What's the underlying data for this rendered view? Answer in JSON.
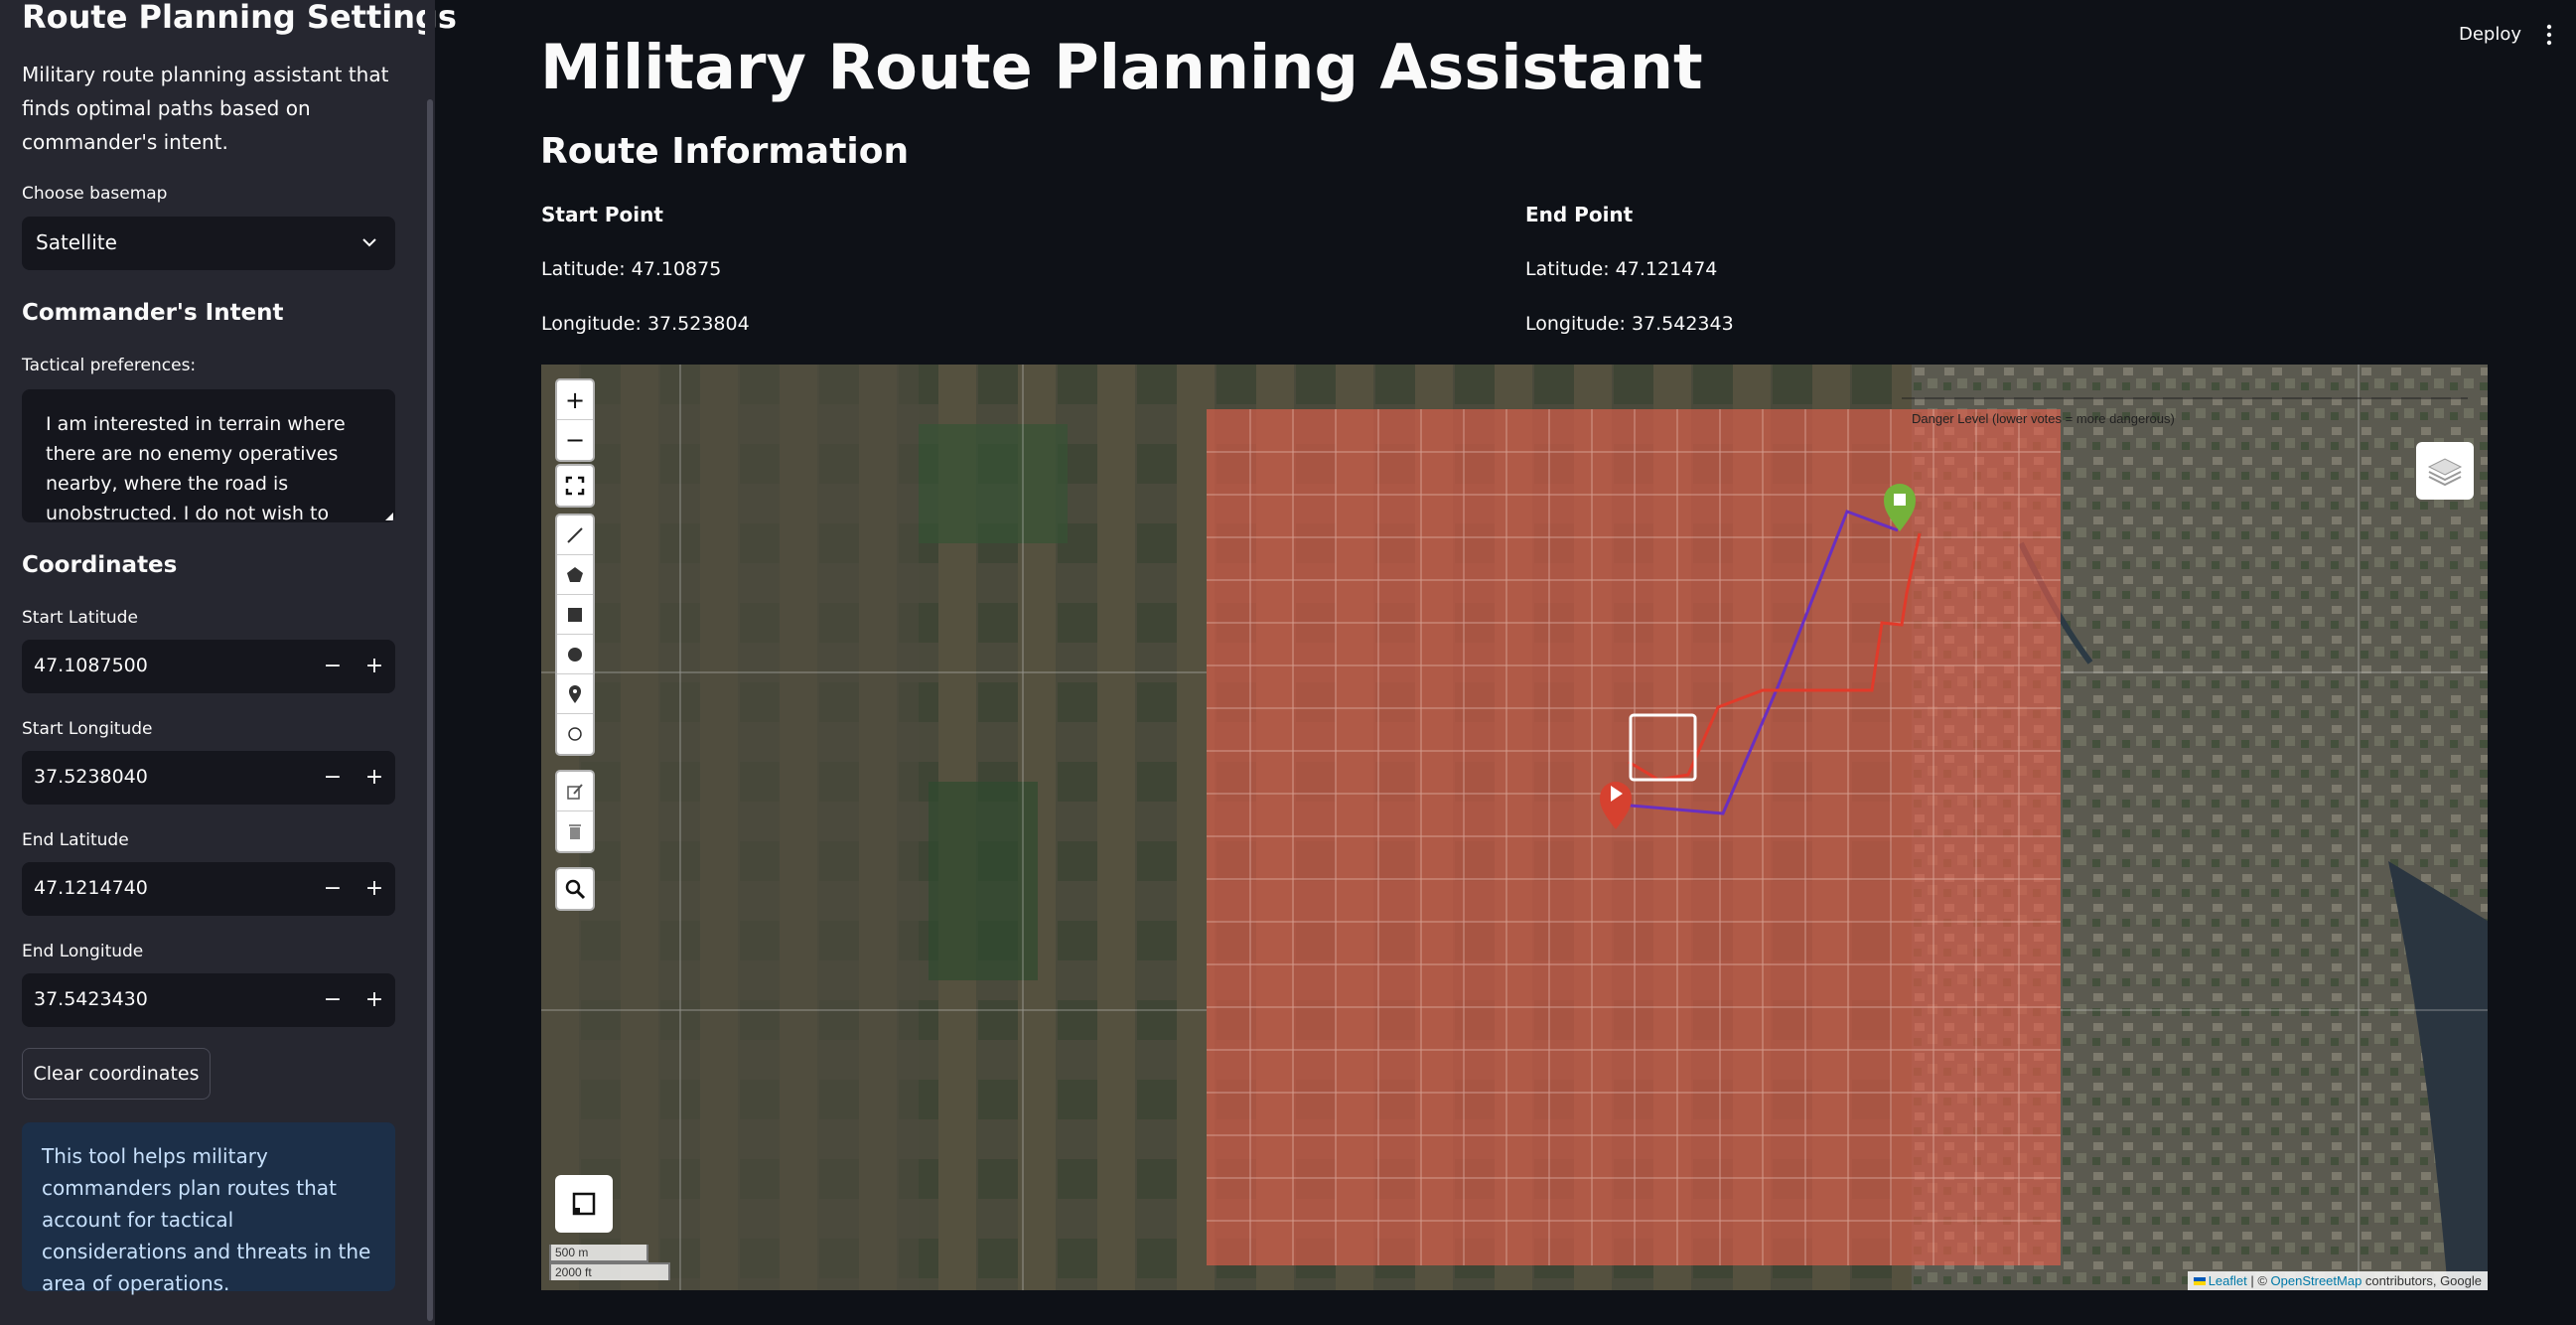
{
  "sidebar": {
    "title": "Route Planning Settings",
    "description": "Military route planning assistant that finds optimal paths based on commander's intent.",
    "basemap_label": "Choose basemap",
    "basemap_value": "Satellite",
    "intent_heading": "Commander's Intent",
    "tactical_label": "Tactical preferences:",
    "tactical_text": "I am interested in terrain where there are no enemy operatives nearby, where the road is unobstructed. I do not wish to pass",
    "coords_heading": "Coordinates",
    "start_lat_label": "Start Latitude",
    "start_lat_value": "47.1087500",
    "start_lon_label": "Start Longitude",
    "start_lon_value": "37.5238040",
    "end_lat_label": "End Latitude",
    "end_lat_value": "47.1214740",
    "end_lon_label": "End Longitude",
    "end_lon_value": "37.5423430",
    "stepper_minus": "−",
    "stepper_plus": "+",
    "clear_label": "Clear coordinates",
    "info_text": "This tool helps military commanders plan routes that account for tactical considerations and threats in the area of operations."
  },
  "topbar": {
    "deploy_label": "Deploy"
  },
  "main": {
    "title": "Military Route Planning Assistant",
    "route_info_heading": "Route Information",
    "start_point_heading": "Start Point",
    "start_latitude": "Latitude: 47.10875",
    "start_longitude": "Longitude: 37.523804",
    "end_point_heading": "End Point",
    "end_latitude": "Latitude: 47.121474",
    "end_longitude": "Longitude: 37.542343"
  },
  "map": {
    "zoom_in": "+",
    "zoom_out": "−",
    "legend_title": "Danger Level (lower votes = more dangerous)",
    "scale_metric": "500 m",
    "scale_imperial": "2000 ft",
    "attribution_leaflet": "Leaflet",
    "attribution_sep": " | © ",
    "attribution_osm": "OpenStreetMap",
    "attribution_rest": " contributors, Google",
    "overlay_color": "#e8604c",
    "route_colors": {
      "primary": "#6a2fc0",
      "alternate": "#e23a2a"
    },
    "markers": {
      "start": "#d6412f",
      "end": "#74b23a"
    }
  }
}
